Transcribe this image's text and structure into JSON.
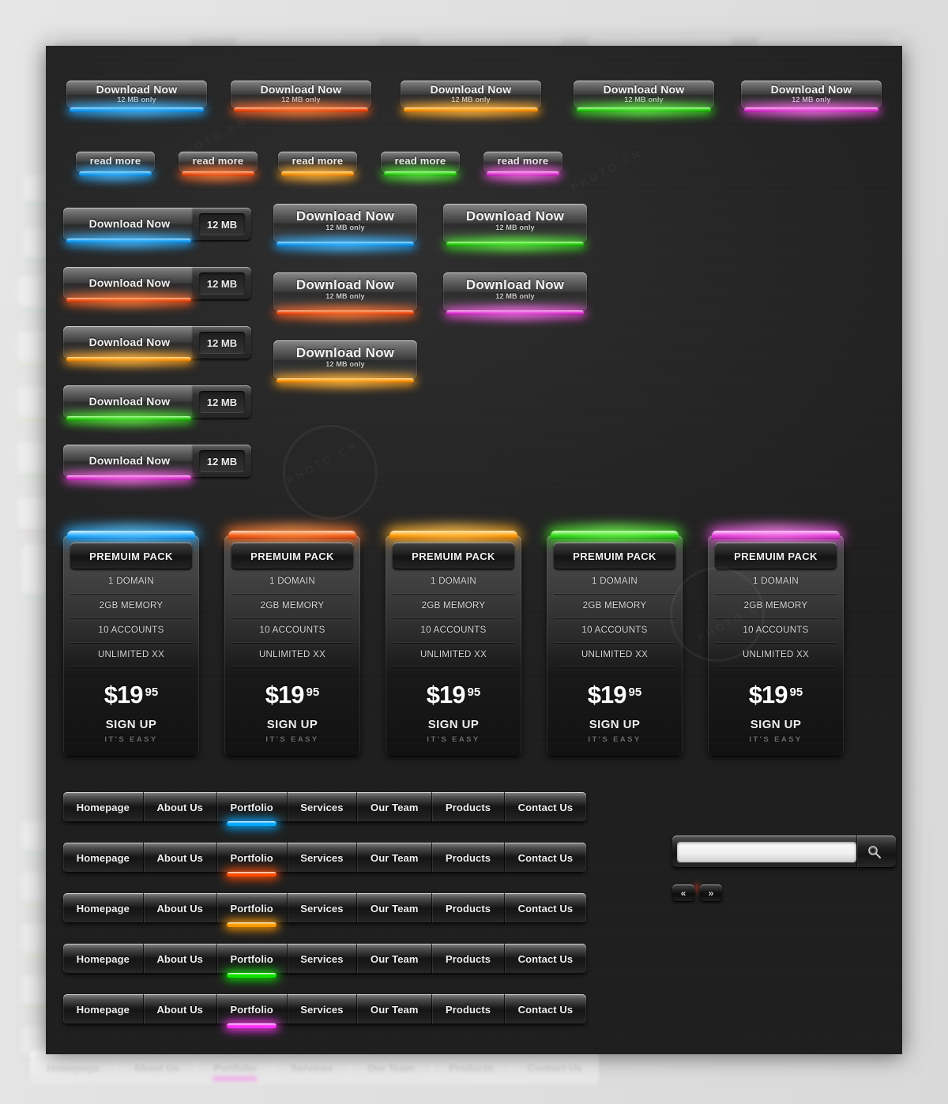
{
  "download_buttons_top": [
    {
      "label": "Download Now",
      "sub": "12 MB only",
      "color": "blue"
    },
    {
      "label": "Download Now",
      "sub": "12 MB only",
      "color": "red"
    },
    {
      "label": "Download Now",
      "sub": "12 MB only",
      "color": "orange"
    },
    {
      "label": "Download Now",
      "sub": "12 MB only",
      "color": "green"
    },
    {
      "label": "Download Now",
      "sub": "12 MB only",
      "color": "magenta"
    }
  ],
  "read_more_buttons": [
    {
      "label": "read more",
      "color": "blue"
    },
    {
      "label": "read more",
      "color": "red"
    },
    {
      "label": "read more",
      "color": "orange"
    },
    {
      "label": "read more",
      "color": "green"
    },
    {
      "label": "read more",
      "color": "magenta"
    }
  ],
  "download_with_badge": [
    {
      "label": "Download Now",
      "badge": "12 MB",
      "color": "blue"
    },
    {
      "label": "Download Now",
      "badge": "12 MB",
      "color": "red"
    },
    {
      "label": "Download Now",
      "badge": "12 MB",
      "color": "orange"
    },
    {
      "label": "Download Now",
      "badge": "12 MB",
      "color": "green"
    },
    {
      "label": "Download Now",
      "badge": "12 MB",
      "color": "magenta"
    }
  ],
  "download_big": [
    {
      "label": "Download Now",
      "sub": "12 MB only",
      "color": "blue"
    },
    {
      "label": "Download Now",
      "sub": "12 MB only",
      "color": "green"
    },
    {
      "label": "Download Now",
      "sub": "12 MB only",
      "color": "red"
    },
    {
      "label": "Download Now",
      "sub": "12 MB only",
      "color": "magenta"
    },
    {
      "label": "Download Now",
      "sub": "12 MB only",
      "color": "orange"
    }
  ],
  "pricing_cards": [
    {
      "title": "PREMUIM PACK",
      "features": [
        "1 DOMAIN",
        "2GB MEMORY",
        "10 ACCOUNTS",
        "UNLIMITED XX"
      ],
      "price_amount": "$19",
      "price_cents": "95",
      "cta": "SIGN UP",
      "cta_sub": "IT'S EASY",
      "color": "blue"
    },
    {
      "title": "PREMUIM PACK",
      "features": [
        "1 DOMAIN",
        "2GB MEMORY",
        "10 ACCOUNTS",
        "UNLIMITED XX"
      ],
      "price_amount": "$19",
      "price_cents": "95",
      "cta": "SIGN UP",
      "cta_sub": "IT'S EASY",
      "color": "red"
    },
    {
      "title": "PREMUIM PACK",
      "features": [
        "1 DOMAIN",
        "2GB MEMORY",
        "10 ACCOUNTS",
        "UNLIMITED XX"
      ],
      "price_amount": "$19",
      "price_cents": "95",
      "cta": "SIGN UP",
      "cta_sub": "IT'S EASY",
      "color": "orange"
    },
    {
      "title": "PREMUIM PACK",
      "features": [
        "1 DOMAIN",
        "2GB MEMORY",
        "10 ACCOUNTS",
        "UNLIMITED XX"
      ],
      "price_amount": "$19",
      "price_cents": "95",
      "cta": "SIGN UP",
      "cta_sub": "IT'S EASY",
      "color": "green"
    },
    {
      "title": "PREMUIM PACK",
      "features": [
        "1 DOMAIN",
        "2GB MEMORY",
        "10 ACCOUNTS",
        "UNLIMITED XX"
      ],
      "price_amount": "$19",
      "price_cents": "95",
      "cta": "SIGN UP",
      "cta_sub": "IT'S EASY",
      "color": "magenta"
    }
  ],
  "navbars": [
    {
      "items": [
        "Homepage",
        "About Us",
        "Portfolio",
        "Services",
        "Our Team",
        "Products",
        "Contact Us"
      ],
      "active": 2,
      "color": "blue"
    },
    {
      "items": [
        "Homepage",
        "About Us",
        "Portfolio",
        "Services",
        "Our Team",
        "Products",
        "Contact Us"
      ],
      "active": 2,
      "color": "red"
    },
    {
      "items": [
        "Homepage",
        "About Us",
        "Portfolio",
        "Services",
        "Our Team",
        "Products",
        "Contact Us"
      ],
      "active": 2,
      "color": "orange"
    },
    {
      "items": [
        "Homepage",
        "About Us",
        "Portfolio",
        "Services",
        "Our Team",
        "Products",
        "Contact Us"
      ],
      "active": 2,
      "color": "green"
    },
    {
      "items": [
        "Homepage",
        "About Us",
        "Portfolio",
        "Services",
        "Our Team",
        "Products",
        "Contact Us"
      ],
      "active": 2,
      "color": "magenta"
    }
  ],
  "ghost_nav": {
    "items": [
      "Homepage",
      "About Us",
      "Portfolio",
      "Services",
      "Our Team",
      "Products",
      "Contact Us"
    ],
    "active": 2
  },
  "search": {
    "value": "",
    "placeholder": "",
    "icon": "search-icon"
  },
  "pager": {
    "prev_label": "«",
    "next_label": "»"
  },
  "watermarks": [
    "PHOTO.CN",
    "PHOTO.CN",
    "PHOTO.CN",
    "PHOTO.CN"
  ],
  "colors": {
    "blue": "#1ba0f2",
    "red": "#f1541a",
    "orange": "#ff9c10",
    "green": "#2ed415",
    "magenta": "#e33fd6",
    "panel_bg": "#262626",
    "page_bg": "#e2e2e2"
  }
}
